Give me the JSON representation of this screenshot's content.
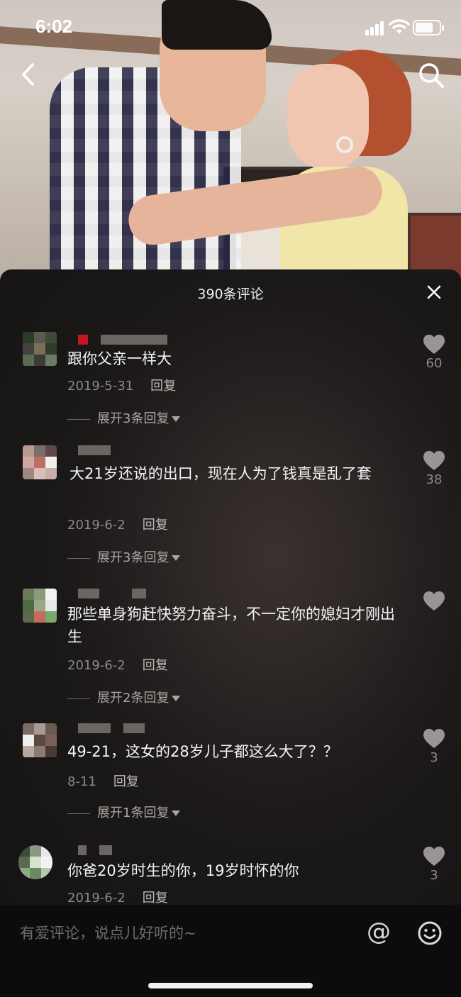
{
  "status_bar": {
    "time": "6:02"
  },
  "header": {
    "back_icon": "chevron-left-icon",
    "search_icon": "search-icon"
  },
  "sheet": {
    "title": "390条评论",
    "close_icon": "close-icon"
  },
  "comments": [
    {
      "text": "跟你父亲一样大",
      "date": "2019-5-31",
      "reply": "回复",
      "likes": "60",
      "expand": "展开3条回复"
    },
    {
      "text": "大21岁还说的出口，现在人为了钱真是乱了套",
      "date": "2019-6-2",
      "reply": "回复",
      "likes": "38",
      "expand": "展开3条回复"
    },
    {
      "text": "那些单身狗赶快努力奋斗，不一定你的媳妇才刚出生",
      "date": "2019-6-2",
      "reply": "回复",
      "likes": "",
      "expand": "展开2条回复"
    },
    {
      "text": "49-21，这女的28岁儿子都这么大了？？",
      "date": "8-11",
      "reply": "回复",
      "likes": "3",
      "expand": "展开1条回复"
    },
    {
      "text": "你爸20岁时生的你，19岁时怀的你",
      "date": "2019-6-2",
      "reply": "回复",
      "likes": "3",
      "expand": ""
    }
  ],
  "input": {
    "placeholder": "有爱评论，说点儿好听的~",
    "at_label": "@",
    "emoji_icon": "emoji-icon"
  },
  "colors": {
    "sheet_bg": "#1b1818",
    "text_secondary": "#8c8888",
    "like_icon": "#9a9594"
  }
}
